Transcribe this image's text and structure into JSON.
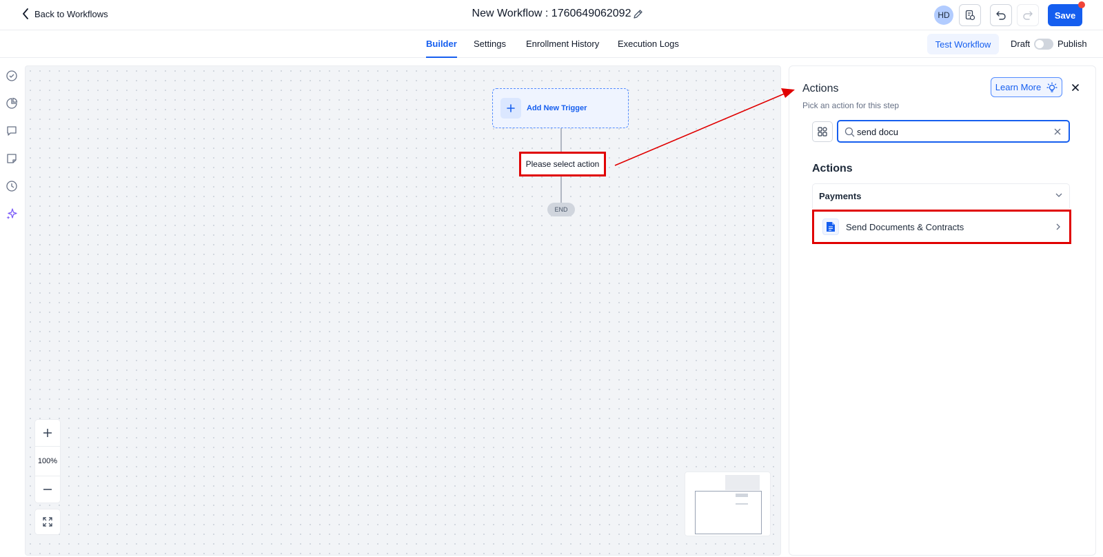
{
  "header": {
    "back_label": "Back to Workflows",
    "workflow_title": "New Workflow : 1760649062092",
    "avatar_initials": "HD",
    "save_label": "Save"
  },
  "tabs": [
    {
      "label": "Builder",
      "active": true
    },
    {
      "label": "Settings",
      "active": false
    },
    {
      "label": "Enrollment History",
      "active": false
    },
    {
      "label": "Execution Logs",
      "active": false
    }
  ],
  "toolbar": {
    "test_workflow_label": "Test Workflow",
    "draft_label": "Draft",
    "publish_label": "Publish",
    "publish_toggle_on": false
  },
  "left_rail": {
    "icons": [
      "check-circle-icon",
      "pie-chart-icon",
      "comment-icon",
      "note-icon",
      "history-icon",
      "sparkles-icon"
    ]
  },
  "canvas": {
    "trigger_label": "Add New Trigger",
    "action_placeholder": "Please select action",
    "end_label": "END",
    "zoom_level": "100%"
  },
  "panel": {
    "title": "Actions",
    "subtitle": "Pick an action for this step",
    "learn_more_label": "Learn More",
    "search_value": "send docu",
    "section_heading": "Actions",
    "category": "Payments",
    "result_item": "Send Documents & Contracts"
  },
  "colors": {
    "accent": "#155eef",
    "annotation_red": "#e00000"
  }
}
